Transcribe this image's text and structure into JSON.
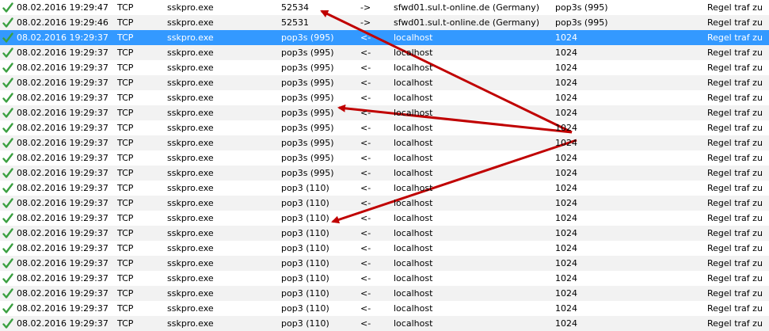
{
  "colors": {
    "selected_row": "#3399ff",
    "alt_row": "#f2f2f2",
    "check": "#3aa040",
    "arrow": "#c00000"
  },
  "icons": {
    "status": "checkmark-icon"
  },
  "rows": [
    {
      "time": "08.02.2016 19:29:47",
      "protocol": "TCP",
      "process": "sskpro.exe",
      "port": "52534",
      "direction": "->",
      "host": "sfwd01.sul.t-online.de (Germany)",
      "remote_port": "pop3s (995)",
      "rule": "Regel traf zu"
    },
    {
      "time": "08.02.2016 19:29:46",
      "protocol": "TCP",
      "process": "sskpro.exe",
      "port": "52531",
      "direction": "->",
      "host": "sfwd01.sul.t-online.de (Germany)",
      "remote_port": "pop3s (995)",
      "rule": "Regel traf zu"
    },
    {
      "time": "08.02.2016 19:29:37",
      "protocol": "TCP",
      "process": "sskpro.exe",
      "port": "pop3s (995)",
      "direction": "<-",
      "host": "localhost",
      "remote_port": "1024",
      "rule": "Regel traf zu",
      "selected": true
    },
    {
      "time": "08.02.2016 19:29:37",
      "protocol": "TCP",
      "process": "sskpro.exe",
      "port": "pop3s (995)",
      "direction": "<-",
      "host": "localhost",
      "remote_port": "1024",
      "rule": "Regel traf zu"
    },
    {
      "time": "08.02.2016 19:29:37",
      "protocol": "TCP",
      "process": "sskpro.exe",
      "port": "pop3s (995)",
      "direction": "<-",
      "host": "localhost",
      "remote_port": "1024",
      "rule": "Regel traf zu"
    },
    {
      "time": "08.02.2016 19:29:37",
      "protocol": "TCP",
      "process": "sskpro.exe",
      "port": "pop3s (995)",
      "direction": "<-",
      "host": "localhost",
      "remote_port": "1024",
      "rule": "Regel traf zu"
    },
    {
      "time": "08.02.2016 19:29:37",
      "protocol": "TCP",
      "process": "sskpro.exe",
      "port": "pop3s (995)",
      "direction": "<-",
      "host": "localhost",
      "remote_port": "1024",
      "rule": "Regel traf zu"
    },
    {
      "time": "08.02.2016 19:29:37",
      "protocol": "TCP",
      "process": "sskpro.exe",
      "port": "pop3s (995)",
      "direction": "<-",
      "host": "localhost",
      "remote_port": "1024",
      "rule": "Regel traf zu"
    },
    {
      "time": "08.02.2016 19:29:37",
      "protocol": "TCP",
      "process": "sskpro.exe",
      "port": "pop3s (995)",
      "direction": "<-",
      "host": "localhost",
      "remote_port": "1024",
      "rule": "Regel traf zu"
    },
    {
      "time": "08.02.2016 19:29:37",
      "protocol": "TCP",
      "process": "sskpro.exe",
      "port": "pop3s (995)",
      "direction": "<-",
      "host": "localhost",
      "remote_port": "1024",
      "rule": "Regel traf zu"
    },
    {
      "time": "08.02.2016 19:29:37",
      "protocol": "TCP",
      "process": "sskpro.exe",
      "port": "pop3s (995)",
      "direction": "<-",
      "host": "localhost",
      "remote_port": "1024",
      "rule": "Regel traf zu"
    },
    {
      "time": "08.02.2016 19:29:37",
      "protocol": "TCP",
      "process": "sskpro.exe",
      "port": "pop3s (995)",
      "direction": "<-",
      "host": "localhost",
      "remote_port": "1024",
      "rule": "Regel traf zu"
    },
    {
      "time": "08.02.2016 19:29:37",
      "protocol": "TCP",
      "process": "sskpro.exe",
      "port": "pop3 (110)",
      "direction": "<-",
      "host": "localhost",
      "remote_port": "1024",
      "rule": "Regel traf zu"
    },
    {
      "time": "08.02.2016 19:29:37",
      "protocol": "TCP",
      "process": "sskpro.exe",
      "port": "pop3 (110)",
      "direction": "<-",
      "host": "localhost",
      "remote_port": "1024",
      "rule": "Regel traf zu"
    },
    {
      "time": "08.02.2016 19:29:37",
      "protocol": "TCP",
      "process": "sskpro.exe",
      "port": "pop3 (110)",
      "direction": "<-",
      "host": "localhost",
      "remote_port": "1024",
      "rule": "Regel traf zu"
    },
    {
      "time": "08.02.2016 19:29:37",
      "protocol": "TCP",
      "process": "sskpro.exe",
      "port": "pop3 (110)",
      "direction": "<-",
      "host": "localhost",
      "remote_port": "1024",
      "rule": "Regel traf zu"
    },
    {
      "time": "08.02.2016 19:29:37",
      "protocol": "TCP",
      "process": "sskpro.exe",
      "port": "pop3 (110)",
      "direction": "<-",
      "host": "localhost",
      "remote_port": "1024",
      "rule": "Regel traf zu"
    },
    {
      "time": "08.02.2016 19:29:37",
      "protocol": "TCP",
      "process": "sskpro.exe",
      "port": "pop3 (110)",
      "direction": "<-",
      "host": "localhost",
      "remote_port": "1024",
      "rule": "Regel traf zu"
    },
    {
      "time": "08.02.2016 19:29:37",
      "protocol": "TCP",
      "process": "sskpro.exe",
      "port": "pop3 (110)",
      "direction": "<-",
      "host": "localhost",
      "remote_port": "1024",
      "rule": "Regel traf zu"
    },
    {
      "time": "08.02.2016 19:29:37",
      "protocol": "TCP",
      "process": "sskpro.exe",
      "port": "pop3 (110)",
      "direction": "<-",
      "host": "localhost",
      "remote_port": "1024",
      "rule": "Regel traf zu"
    },
    {
      "time": "08.02.2016 19:29:37",
      "protocol": "TCP",
      "process": "sskpro.exe",
      "port": "pop3 (110)",
      "direction": "<-",
      "host": "localhost",
      "remote_port": "1024",
      "rule": "Regel traf zu"
    },
    {
      "time": "08.02.2016 19:29:37",
      "protocol": "TCP",
      "process": "sskpro.exe",
      "port": "pop3 (110)",
      "direction": "<-",
      "host": "localhost",
      "remote_port": "1024",
      "rule": "Regel traf zu"
    }
  ]
}
